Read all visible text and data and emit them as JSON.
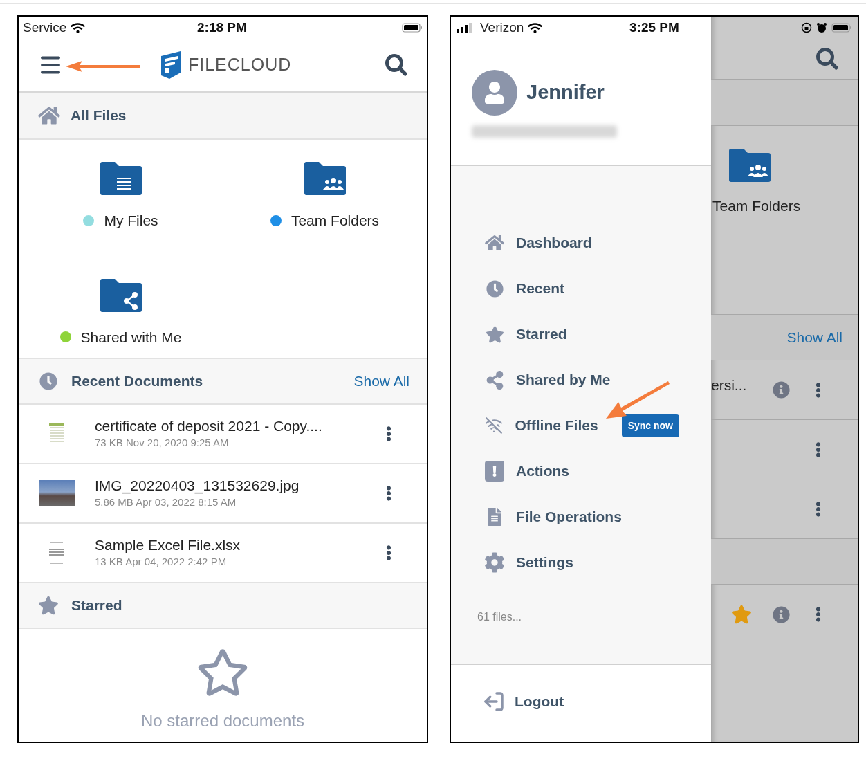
{
  "left_screen": {
    "status_bar": {
      "carrier": "Service",
      "time": "2:18 PM"
    },
    "header": {
      "logo_text": "FILECLOUD"
    },
    "all_files": {
      "title": "All Files"
    },
    "folders": [
      {
        "label": "My Files",
        "kind": "documents",
        "color": "#93dde0"
      },
      {
        "label": "Team Folders",
        "kind": "team",
        "color": "#1f8fe6"
      },
      {
        "label": "Shared with Me",
        "kind": "shared",
        "color": "#8fd43a"
      }
    ],
    "recent": {
      "title": "Recent Documents",
      "show_all": "Show All",
      "rows": [
        {
          "name": "certificate of deposit 2021 - Copy....",
          "meta": "73 KB Nov 20, 2020 9:25 AM",
          "kind": "spreadsheet"
        },
        {
          "name": "IMG_20220403_131532629.jpg",
          "meta": "5.86 MB Apr 03, 2022 8:15 AM",
          "kind": "photo"
        },
        {
          "name": "Sample Excel File.xlsx",
          "meta": "13 KB Apr 04, 2022 2:42 PM",
          "kind": "sheet"
        }
      ]
    },
    "starred": {
      "title": "Starred",
      "empty_text": "No starred documents"
    }
  },
  "right_screen": {
    "status_bar": {
      "carrier": "Verizon",
      "time": "3:25 PM"
    },
    "user": {
      "name": "Jennifer"
    },
    "menu": [
      {
        "label": "Dashboard",
        "kind": "home"
      },
      {
        "label": "Recent",
        "kind": "clock"
      },
      {
        "label": "Starred",
        "kind": "star"
      },
      {
        "label": "Shared by Me",
        "kind": "share"
      },
      {
        "label": "Offline Files",
        "kind": "offline",
        "badge": "Sync now"
      },
      {
        "label": "Actions",
        "kind": "alert"
      },
      {
        "label": "File Operations",
        "kind": "file"
      },
      {
        "label": "Settings",
        "kind": "gear"
      }
    ],
    "footer_text": "61 files...",
    "logout": "Logout",
    "background": {
      "folder_label": "Team Folders",
      "show_all": "Show All",
      "rows": [
        {
          "name": "ersi...",
          "info": true,
          "starred": false
        },
        {
          "info": false,
          "starred": false
        },
        {
          "info": false,
          "starred": false
        }
      ],
      "starred_rows": [
        {
          "info": true,
          "starred": true
        }
      ]
    }
  }
}
